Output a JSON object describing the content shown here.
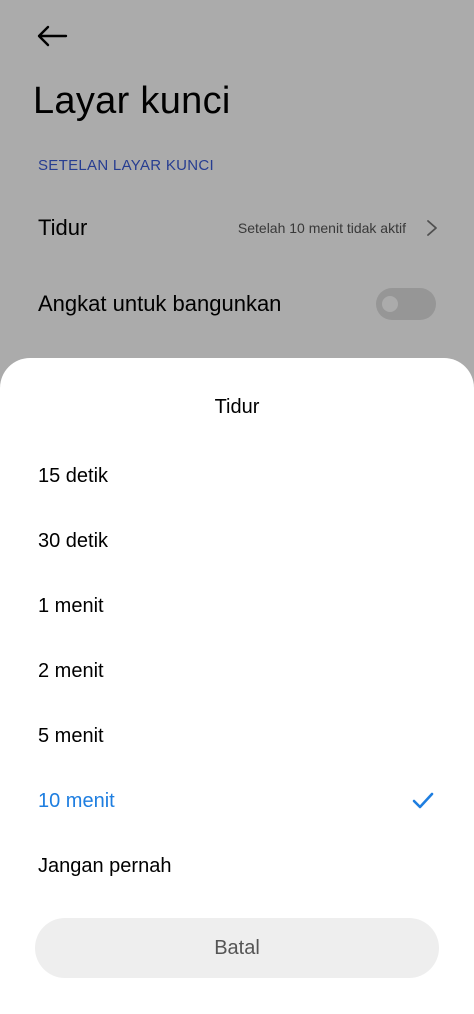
{
  "header": {
    "back_icon": "arrow-left-icon",
    "title": "Layar kunci"
  },
  "section": {
    "header": "SETELAN LAYAR KUNCI"
  },
  "settings": {
    "sleep": {
      "label": "Tidur",
      "value": "Setelah 10 menit tidak aktif",
      "icon": "chevron-right-icon"
    },
    "raise_to_wake": {
      "label": "Angkat untuk bangunkan",
      "enabled": false
    }
  },
  "sheet": {
    "title": "Tidur",
    "options": [
      {
        "label": "15 detik",
        "selected": false
      },
      {
        "label": "30 detik",
        "selected": false
      },
      {
        "label": "1 menit",
        "selected": false
      },
      {
        "label": "2 menit",
        "selected": false
      },
      {
        "label": "5 menit",
        "selected": false
      },
      {
        "label": "10 menit",
        "selected": true
      },
      {
        "label": "Jangan pernah",
        "selected": false
      }
    ],
    "cancel_label": "Batal"
  },
  "colors": {
    "accent": "#1e7ee0",
    "section_header": "#3a5bd9",
    "scrim": "rgba(0,0,0,0.33)"
  }
}
